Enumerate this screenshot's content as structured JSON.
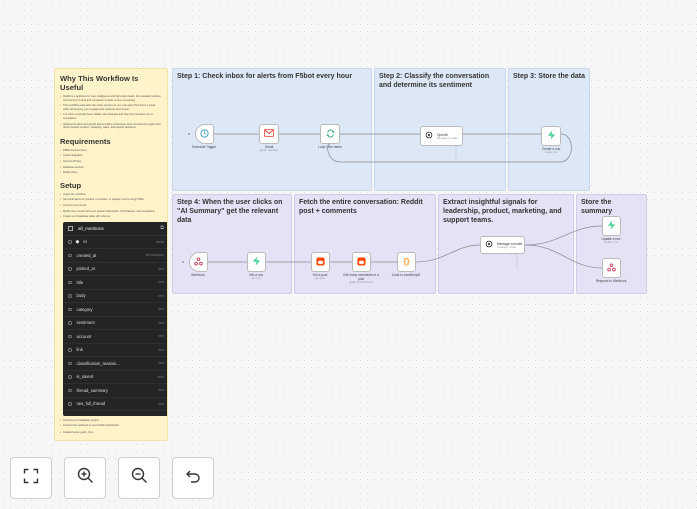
{
  "note": {
    "heading_why": "Why This Workflow Is Useful",
    "why_bullets": [
      "Reddit is a goldmine for user intelligence and high-intent leads, but manually tracking comments for brand and competitor threads is time-consuming.",
      "This workflow automates the entire process so you only spend 5-6 hours a week, while still keeping your engagement authentic and human.",
      "It is inbox email alert feed, dislike, alert changes and how they compare you to competition.",
      "Helping founders and growth teams build a continuous voice-of-customer engine that drives smarter product, marketing, sales, and support decisions."
    ],
    "heading_req": "Requirements",
    "req_bullets": [
      "F5Bot account (free)",
      "Gmail integration",
      "OpenAI API key",
      "Database account",
      "Reddit (free)"
    ],
    "heading_setup": "Setup",
    "setup_bullets": [
      "Import the workflow",
      "Set email alerts for product, competitor, or category terms using F5Bot",
      "Connect your Gmail",
      "Modify the prompts with your product description, ICP, features, and competitors",
      "Create your Database table with schema:"
    ],
    "after_bullets": [
      "Connect your Database project",
      "Connect the webhook to your Notifier dashboard"
    ],
    "guide": "Detailed setup guide: here"
  },
  "table": {
    "name": "all_mentions",
    "rows": [
      {
        "name": "id",
        "type": "serial"
      },
      {
        "name": "created_at",
        "type": "timestamptz"
      },
      {
        "name": "posted_at",
        "type": "text"
      },
      {
        "name": "title",
        "type": "text"
      },
      {
        "name": "body",
        "type": "text"
      },
      {
        "name": "category",
        "type": "text"
      },
      {
        "name": "sentiment",
        "type": "text"
      },
      {
        "name": "account",
        "type": "text"
      },
      {
        "name": "link",
        "type": "text"
      },
      {
        "name": "classification_reasoni...",
        "type": "text"
      },
      {
        "name": "is_saved",
        "type": "bool"
      },
      {
        "name": "thread_summary",
        "type": "text"
      },
      {
        "name": "raw_full_thread",
        "type": "text"
      }
    ]
  },
  "sections": {
    "step1": "Step 1: Check inbox for alerts from F5bot every hour",
    "step2": "Step 2: Classify the conversation and determine its sentiment",
    "step3": "Step 3: Store the data",
    "step4": "Step 4: When the user clicks on \"AI Summary\" get the relevant data",
    "fetch": "Fetch the entire conversation: Reddit post + comments",
    "extract": "Extract insightful signals for leadership, product, marketing, and support teams.",
    "store": "Store the summary"
  },
  "nodes": {
    "schedule": {
      "label": "Schedule Trigger"
    },
    "gmail": {
      "label": "Gmail",
      "sub": "getAll: message"
    },
    "loop": {
      "label": "Loop Over Items"
    },
    "openai": {
      "label": "OpenAI",
      "sub": "Message a model"
    },
    "create_row": {
      "label": "Create a row",
      "sub": "create: row"
    },
    "webhook": {
      "label": "Webhook"
    },
    "get_row": {
      "label": "Get a row",
      "sub": "get: row"
    },
    "get_post": {
      "label": "Get a post",
      "sub": "get: post"
    },
    "get_comments": {
      "label": "Get many comments in a post",
      "sub": "getAll: postComment"
    },
    "code": {
      "label": "Code in JavaScript2"
    },
    "message_model": {
      "label": "Message a model",
      "sub": "message: model"
    },
    "update_row": {
      "label": "Update a row",
      "sub": "update: row"
    },
    "respond": {
      "label": "Respond to Webhook"
    }
  },
  "colors": {
    "note_bg": "#fff4c9",
    "section_blue": "#dce8f6",
    "section_purple": "#e4e2f5",
    "database_green": "#3ecf8e",
    "reddit_orange": "#ff4500",
    "gmail_red": "#ea4335",
    "code_orange": "#ff9b26"
  },
  "controls": {
    "fit": "fit-view-icon",
    "zoom_in": "zoom-in-icon",
    "zoom_out": "zoom-out-icon",
    "reset": "reset-zoom-icon"
  }
}
